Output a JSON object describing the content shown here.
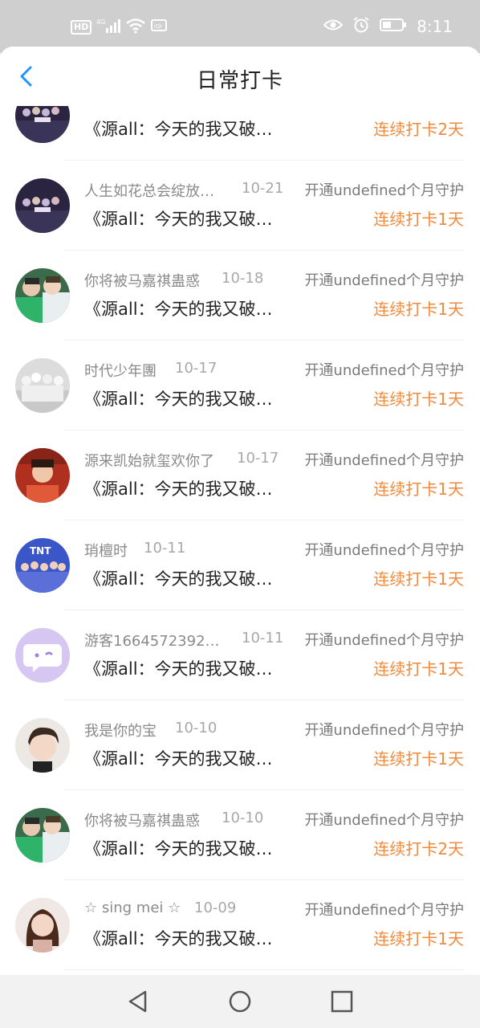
{
  "statusbar": {
    "hd": "HD",
    "signal": "4G",
    "wifi_badge": "4G",
    "time": "8:11"
  },
  "header": {
    "title": "日常打卡"
  },
  "rows": [
    {
      "name": "",
      "date": "",
      "guard": "",
      "post": "《源all：今天的我又破…",
      "streak": "连续打卡2天",
      "avatar": "group-poster"
    },
    {
      "name": "人生如花总会绽放…",
      "date": "10-21",
      "guard": "开通undefined个月守护",
      "post": "《源all：今天的我又破…",
      "streak": "连续打卡1天",
      "avatar": "group-poster"
    },
    {
      "name": "你将被马嘉祺蛊惑",
      "date": "10-18",
      "guard": "开通undefined个月守护",
      "post": "《源all：今天的我又破…",
      "streak": "连续打卡1天",
      "avatar": "two-people-green"
    },
    {
      "name": "时代少年團",
      "date": "10-17",
      "guard": "开通undefined个月守护",
      "post": "《源all：今天的我又破…",
      "streak": "连续打卡1天",
      "avatar": "group-gray"
    },
    {
      "name": "源来凯始就玺欢你了",
      "date": "10-17",
      "guard": "开通undefined个月守护",
      "post": "《源all：今天的我又破…",
      "streak": "连续打卡1天",
      "avatar": "red-portrait"
    },
    {
      "name": "琑檀时",
      "date": "10-11",
      "guard": "开通undefined个月守护",
      "post": "《源all：今天的我又破…",
      "streak": "连续打卡1天",
      "avatar": "group-blue"
    },
    {
      "name": "游客1664572392…",
      "date": "10-11",
      "guard": "开通undefined个月守护",
      "post": "《源all：今天的我又破…",
      "streak": "连续打卡1天",
      "avatar": "default-purple"
    },
    {
      "name": "我是你的宝",
      "date": "10-10",
      "guard": "开通undefined个月守护",
      "post": "《源all：今天的我又破…",
      "streak": "连续打卡1天",
      "avatar": "boy-portrait"
    },
    {
      "name": "你将被马嘉祺蛊惑",
      "date": "10-10",
      "guard": "开通undefined个月守护",
      "post": "《源all：今天的我又破…",
      "streak": "连续打卡2天",
      "avatar": "two-people-green"
    },
    {
      "name": "☆ sing mei ☆",
      "date": "10-09",
      "guard": "开通undefined个月守护",
      "post": "《源all：今天的我又破…",
      "streak": "连续打卡1天",
      "avatar": "girl-portrait"
    }
  ],
  "colors": {
    "accent": "#2196f3",
    "streak": "#f08a3c"
  },
  "navbar": {
    "back_icon": "triangle-back-icon",
    "home_icon": "circle-home-icon",
    "recents_icon": "square-recents-icon"
  }
}
